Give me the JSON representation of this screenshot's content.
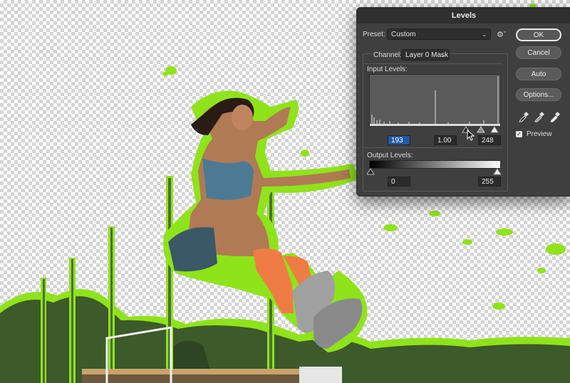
{
  "dialog": {
    "title": "Levels",
    "preset_label": "Preset:",
    "preset_value": "Custom",
    "channel_label": "Channel:",
    "channel_value": "Layer 0 Mask",
    "input_levels_label": "Input Levels:",
    "input_black": "193",
    "input_gamma": "1.00",
    "input_white": "248",
    "output_levels_label": "Output Levels:",
    "output_black": "0",
    "output_white": "255",
    "buttons": {
      "ok": "OK",
      "cancel": "Cancel",
      "auto": "Auto",
      "options": "Options..."
    },
    "preview_label": "Preview",
    "preview_checked": true
  },
  "icons": [
    "gear-icon",
    "chevron-down-icon",
    "black-eyedropper-icon",
    "gray-eyedropper-icon",
    "white-eyedropper-icon",
    "check-icon",
    "cursor-icon"
  ],
  "colors": {
    "mask_outline": "#8fe31a",
    "dialog_bg": "#3f3f3f",
    "selection": "#2458a6"
  }
}
